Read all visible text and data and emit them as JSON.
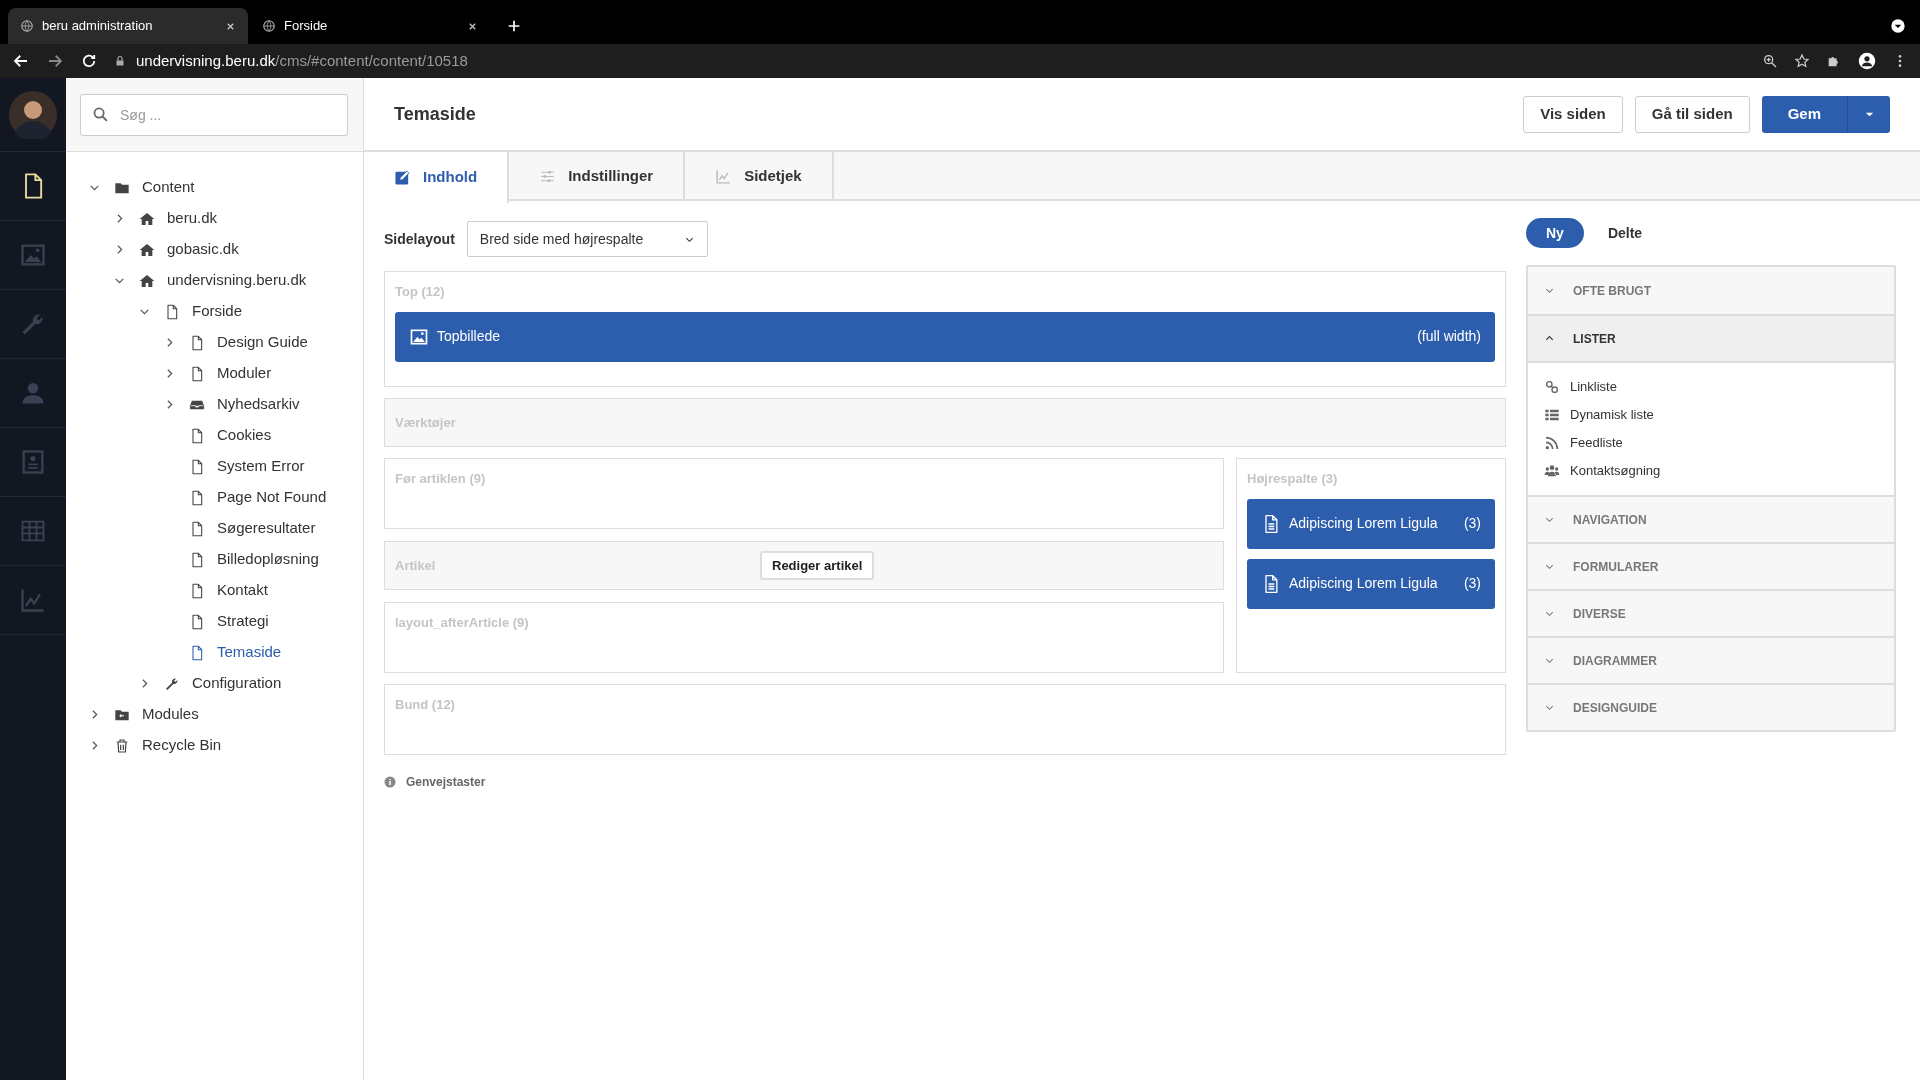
{
  "browser": {
    "tabs": [
      {
        "title": "beru administration",
        "selected": true
      },
      {
        "title": "Forside",
        "selected": false
      }
    ],
    "address": {
      "host": "undervisning.beru.dk",
      "path": "/cms/#content/content/10518"
    }
  },
  "rail": [
    {
      "kind": "page",
      "selected": true
    },
    {
      "kind": "image",
      "selected": false
    },
    {
      "kind": "wrench",
      "selected": false
    },
    {
      "kind": "user",
      "selected": false
    },
    {
      "kind": "card",
      "selected": false
    },
    {
      "kind": "table",
      "selected": false
    },
    {
      "kind": "chart",
      "selected": false
    }
  ],
  "sidebar": {
    "search": {
      "placeholder": "Søg ..."
    },
    "tree": [
      {
        "label": "Content",
        "kind": "folder",
        "expanded": true,
        "selected": false,
        "children": [
          {
            "label": "beru.dk",
            "kind": "home",
            "expanded": false,
            "selected": false
          },
          {
            "label": "gobasic.dk",
            "kind": "home",
            "expanded": false,
            "selected": false
          },
          {
            "label": "undervisning.beru.dk",
            "kind": "home",
            "expanded": true,
            "selected": false,
            "children": [
              {
                "label": "Forside",
                "kind": "page",
                "expanded": true,
                "selected": false,
                "children": [
                  {
                    "label": "Design Guide",
                    "kind": "page",
                    "expanded": false,
                    "selected": false
                  },
                  {
                    "label": "Moduler",
                    "kind": "page",
                    "expanded": false,
                    "selected": false
                  },
                  {
                    "label": "Nyhedsarkiv",
                    "kind": "archive",
                    "expanded": false,
                    "selected": false
                  },
                  {
                    "label": "Cookies",
                    "kind": "page",
                    "selected": false
                  },
                  {
                    "label": "System Error",
                    "kind": "page",
                    "selected": false
                  },
                  {
                    "label": "Page Not Found",
                    "kind": "page",
                    "selected": false
                  },
                  {
                    "label": "Søgeresultater",
                    "kind": "page",
                    "selected": false
                  },
                  {
                    "label": "Billedopløsning",
                    "kind": "page",
                    "selected": false
                  },
                  {
                    "label": "Kontakt",
                    "kind": "page",
                    "selected": false
                  },
                  {
                    "label": "Strategi",
                    "kind": "page",
                    "selected": false
                  },
                  {
                    "label": "Temaside",
                    "kind": "page",
                    "selected": true
                  }
                ]
              },
              {
                "label": "Configuration",
                "kind": "wrench",
                "expanded": false,
                "selected": false
              }
            ]
          }
        ]
      },
      {
        "label": "Modules",
        "kind": "modules",
        "expanded": false,
        "selected": false
      },
      {
        "label": "Recycle Bin",
        "kind": "trash",
        "expanded": false,
        "selected": false
      }
    ]
  },
  "header": {
    "title": "Temaside",
    "buttons": [
      {
        "label": "Vis siden",
        "kind": "default"
      },
      {
        "label": "Gå til siden",
        "kind": "default"
      },
      {
        "label": "Gem",
        "kind": "primary"
      }
    ]
  },
  "tabs": [
    {
      "label": "Indhold",
      "kind": "edit",
      "selected": true
    },
    {
      "label": "Indstillinger",
      "kind": "sliders",
      "selected": false
    },
    {
      "label": "Sidetjek",
      "kind": "chart",
      "selected": false
    }
  ],
  "layout": {
    "label": "Sidelayout",
    "value": "Bred side med højrespalte"
  },
  "zones": [
    {
      "kind": "zone",
      "title": "Top (12)",
      "blocks": [
        {
          "kind": "image",
          "label": "Topbillede",
          "note": "(full width)"
        }
      ]
    },
    {
      "kind": "bar",
      "title": "Værktøjer"
    },
    {
      "kind": "split",
      "left": [
        {
          "kind": "zone",
          "title": "Før artiklen (9)"
        },
        {
          "kind": "article",
          "title": "Artikel",
          "button": "Rediger artikel"
        },
        {
          "kind": "zone",
          "title": "layout_afterArticle (9)"
        }
      ],
      "right": {
        "kind": "zone",
        "title": "Højrespalte (3)",
        "blocks": [
          {
            "kind": "document",
            "label": "Adipiscing Lorem Ligula",
            "note": "(3)"
          },
          {
            "kind": "document",
            "label": "Adipiscing Lorem Ligula",
            "note": "(3)"
          }
        ]
      }
    },
    {
      "kind": "zone",
      "title": "Bund (12)"
    }
  ],
  "shortcuts": "Genvejstaster",
  "library": {
    "toggle": [
      {
        "label": "Ny",
        "selected": true
      },
      {
        "label": "Delte",
        "selected": false
      }
    ],
    "sections": [
      {
        "title": "OFTE BRUGT",
        "expanded": false
      },
      {
        "title": "LISTER",
        "expanded": true,
        "items": [
          {
            "label": "Linkliste",
            "kind": "link"
          },
          {
            "label": "Dynamisk liste",
            "kind": "list"
          },
          {
            "label": "Feedliste",
            "kind": "rss"
          },
          {
            "label": "Kontaktsøgning",
            "kind": "users"
          }
        ]
      },
      {
        "title": "NAVIGATION",
        "expanded": false
      },
      {
        "title": "FORMULARER",
        "expanded": false
      },
      {
        "title": "DIVERSE",
        "expanded": false
      },
      {
        "title": "DIAGRAMMER",
        "expanded": false
      },
      {
        "title": "DESIGNGUIDE",
        "expanded": false
      }
    ]
  }
}
